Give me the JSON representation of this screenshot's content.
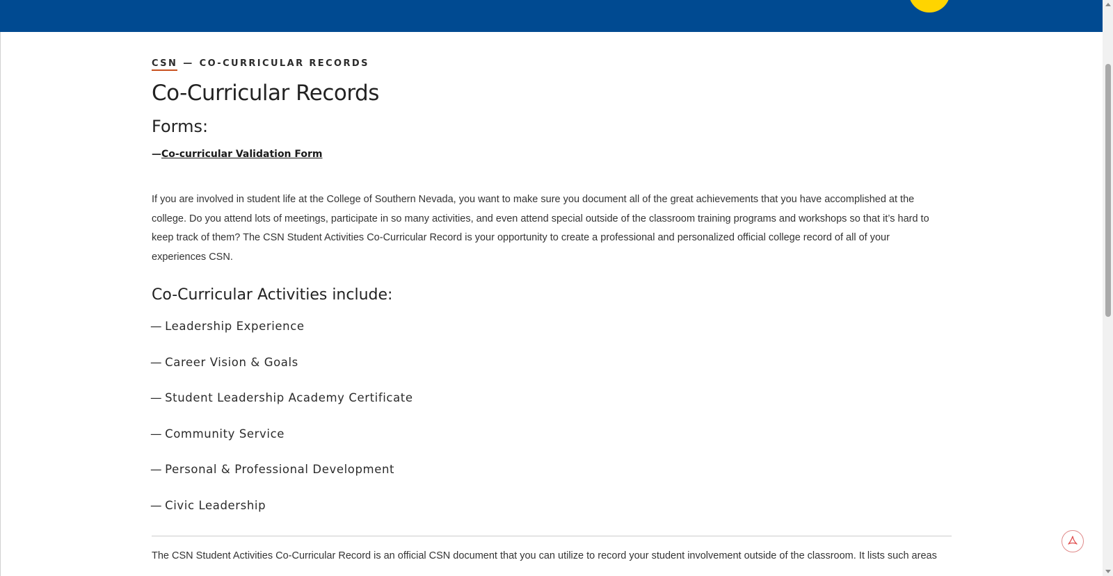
{
  "header": {
    "logo_icon": "csn-logo-circle",
    "brand_color": "#004a91",
    "logo_color": "#ffd400"
  },
  "breadcrumb": {
    "home": "CSN",
    "separator": "—",
    "current": "CO-CURRICULAR RECORDS"
  },
  "page": {
    "title": "Co-Curricular Records",
    "forms_heading": "Forms:",
    "form_link_dash": "—",
    "form_link": "Co-curricular Validation Form",
    "intro": "If you are involved in student life at the College of Southern Nevada, you want to make sure you document all of the great achievements that you have accomplished at the college.  Do you attend lots of meetings, participate in so many activities, and even attend special outside of the classroom training programs and workshops so that it’s hard to keep track of them? The CSN Student Activities Co-Curricular Record is your opportunity to create a professional and personalized official college record of all of your experiences CSN.",
    "activities_heading": "Co-Curricular Activities include:",
    "activities": [
      {
        "dash": "—",
        "label": "Leadership Experience"
      },
      {
        "dash": "—",
        "label": "Career Vision & Goals"
      },
      {
        "dash": "—",
        "label": "Student Leadership Academy Certificate"
      },
      {
        "dash": "—",
        "label": "Community Service"
      },
      {
        "dash": "—",
        "label": "Personal & Professional Development"
      },
      {
        "dash": "—",
        "label": "Civic Leadership"
      }
    ],
    "bottom_text": "The CSN Student Activities Co-Curricular Record is an official CSN document that you can utilize to record your student involvement outside of the classroom. It lists such areas"
  },
  "floating": {
    "pdf_icon": "pdf-icon",
    "pdf_color": "#e05050"
  }
}
